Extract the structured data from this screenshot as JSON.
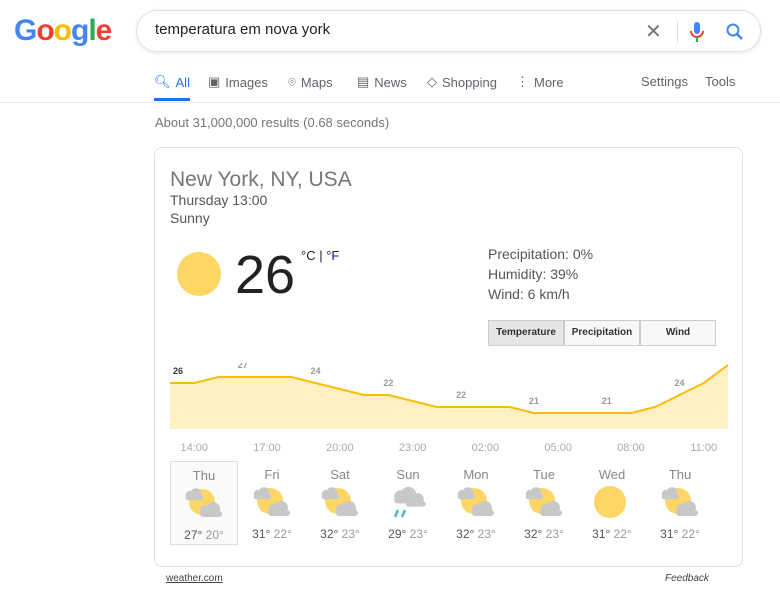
{
  "logo": "Google",
  "search": {
    "query": "temperatura em nova york"
  },
  "tabs": [
    {
      "label": "All",
      "icon": "search-icon"
    },
    {
      "label": "Images",
      "icon": "image-icon"
    },
    {
      "label": "Maps",
      "icon": "map-pin-icon"
    },
    {
      "label": "News",
      "icon": "news-icon"
    },
    {
      "label": "Shopping",
      "icon": "tag-icon"
    },
    {
      "label": "More",
      "icon": "more-icon"
    }
  ],
  "tools": {
    "settings": "Settings",
    "tools": "Tools"
  },
  "stats": "About 31,000,000 results (0.68 seconds)",
  "weather": {
    "location": "New York, NY, USA",
    "time": "Thursday 13:00",
    "condition": "Sunny",
    "temp": "26",
    "unit_c": "°C",
    "sep": "|",
    "unit_f": "°F",
    "precipitation": "Precipitation: 0%",
    "humidity": "Humidity: 39%",
    "wind": "Wind: 6 km/h",
    "buttons": [
      "Temperature",
      "Precipitation",
      "Wind"
    ],
    "colors": {
      "line": "#fbbc04",
      "fill": "#fef0c3",
      "sun": "#fdd663",
      "link": "#1a0dab"
    }
  },
  "chart_data": {
    "type": "area",
    "x_labels": [
      "14:00",
      "17:00",
      "20:00",
      "23:00",
      "02:00",
      "05:00",
      "08:00",
      "11:00"
    ],
    "hours": [
      "13:00",
      "14:00",
      "15:00",
      "16:00",
      "17:00",
      "18:00",
      "19:00",
      "20:00",
      "21:00",
      "22:00",
      "23:00",
      "00:00",
      "01:00",
      "02:00",
      "03:00",
      "04:00",
      "05:00",
      "06:00",
      "07:00",
      "08:00",
      "09:00",
      "10:00",
      "11:00",
      "12:00"
    ],
    "values": [
      26,
      26,
      27,
      27,
      27,
      27,
      26,
      25,
      24,
      24,
      23,
      22,
      22,
      22,
      22,
      21,
      21,
      21,
      21,
      21,
      22,
      24,
      26,
      29
    ],
    "data_labels": [
      {
        "i": 0,
        "v": "26"
      },
      {
        "i": 3,
        "v": "27"
      },
      {
        "i": 6,
        "v": "24"
      },
      {
        "i": 9,
        "v": "22"
      },
      {
        "i": 12,
        "v": "22"
      },
      {
        "i": 15,
        "v": "21"
      },
      {
        "i": 18,
        "v": "21"
      },
      {
        "i": 21,
        "v": "24"
      },
      {
        "i": 23,
        "v": "29"
      }
    ]
  },
  "forecast": [
    {
      "day": "Thu",
      "icon": "partly-cloudy-icon",
      "hi": "27°",
      "lo": "20°"
    },
    {
      "day": "Fri",
      "icon": "partly-cloudy-icon",
      "hi": "31°",
      "lo": "22°"
    },
    {
      "day": "Sat",
      "icon": "partly-cloudy-icon",
      "hi": "32°",
      "lo": "23°"
    },
    {
      "day": "Sun",
      "icon": "rain-icon",
      "hi": "29°",
      "lo": "23°"
    },
    {
      "day": "Mon",
      "icon": "partly-cloudy-icon",
      "hi": "32°",
      "lo": "23°"
    },
    {
      "day": "Tue",
      "icon": "partly-cloudy-icon",
      "hi": "32°",
      "lo": "23°"
    },
    {
      "day": "Wed",
      "icon": "sun-icon",
      "hi": "31°",
      "lo": "22°"
    },
    {
      "day": "Thu",
      "icon": "partly-cloudy-icon",
      "hi": "31°",
      "lo": "22°"
    }
  ],
  "footer": {
    "source": "weather.com",
    "feedback": "Feedback"
  }
}
